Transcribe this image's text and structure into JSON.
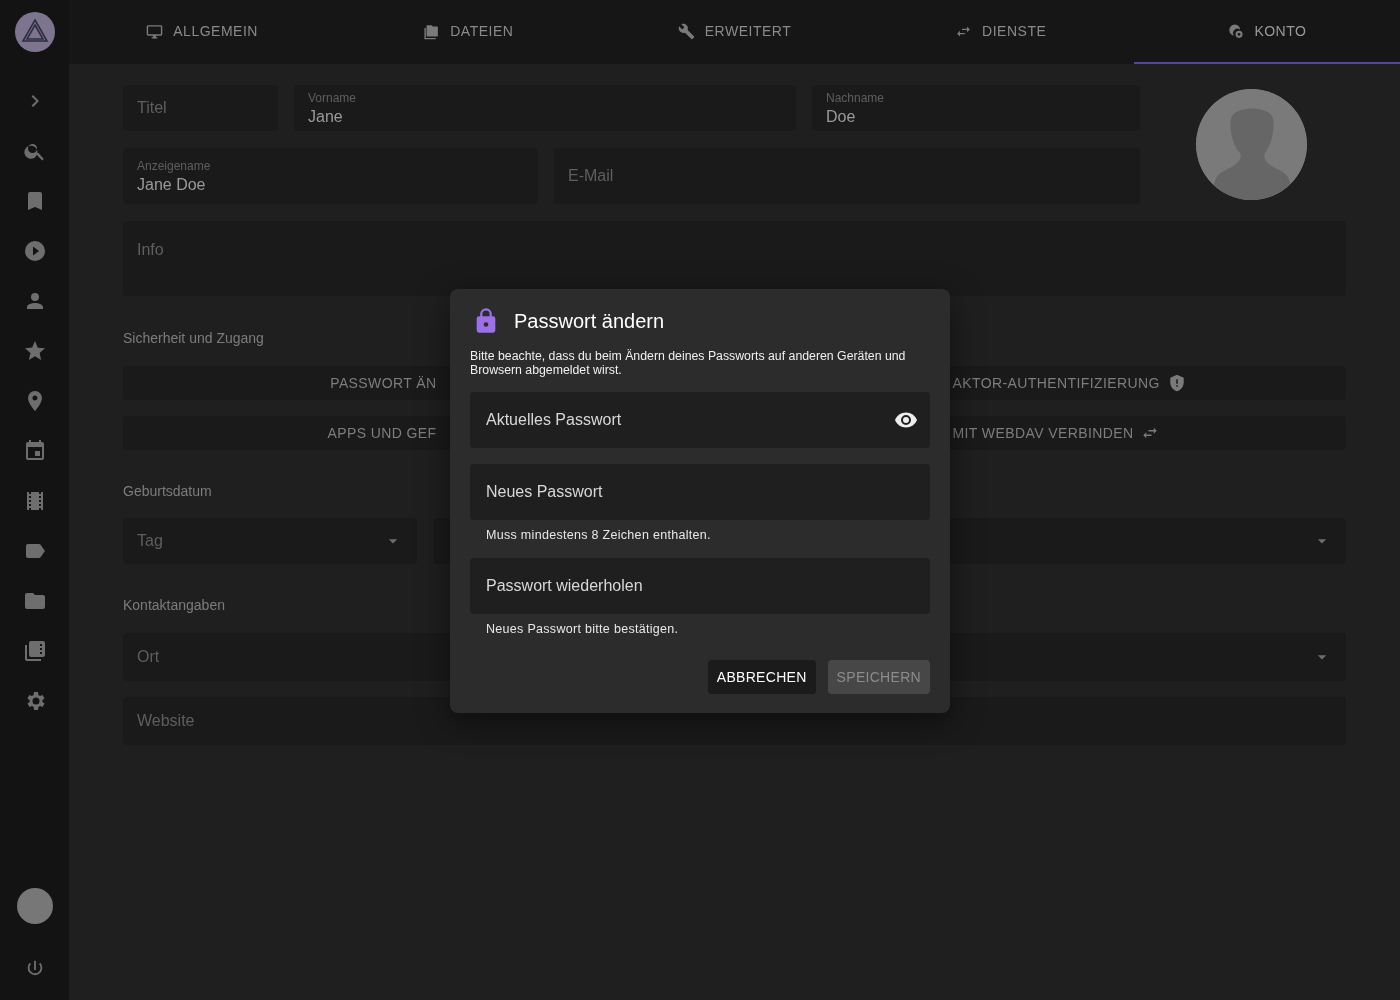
{
  "tabs": [
    {
      "label": "ALLGEMEIN",
      "selected": false
    },
    {
      "label": "DATEIEN",
      "selected": false
    },
    {
      "label": "ERWEITERT",
      "selected": false
    },
    {
      "label": "DIENSTE",
      "selected": false
    },
    {
      "label": "KONTO",
      "selected": true
    }
  ],
  "profile": {
    "fields": [
      {
        "placeholder": "Titel"
      },
      {
        "label": "Vorname",
        "value": "Jane"
      },
      {
        "label": "Nachname",
        "value": "Doe"
      },
      {
        "label": "Anzeigename",
        "value": "Jane Doe"
      },
      {
        "placeholder": "E-Mail"
      },
      {
        "placeholder": "Info"
      }
    ]
  },
  "security": {
    "heading": "Sicherheit und Zugang",
    "buttons": [
      {
        "label": "PASSWORT ÄN"
      },
      {
        "label": "AKTOR-AUTHENTIFIZIERUNG"
      },
      {
        "label": "APPS UND GEF"
      },
      {
        "label": "MIT WEBDAV VERBINDEN"
      }
    ]
  },
  "birthday": {
    "heading": "Geburtsdatum",
    "day": {
      "placeholder": "Tag"
    }
  },
  "contact": {
    "heading": "Kontaktangaben",
    "fields": [
      {
        "kind": "text",
        "placeholder": "Ort"
      },
      {
        "kind": "select"
      },
      {
        "kind": "text",
        "placeholder": "Website"
      }
    ]
  },
  "dialog": {
    "title": "Passwort ändern",
    "message": "Bitte beachte, dass du beim Ändern deines Passworts auf anderen Geräten und Browsern abgemeldet wirst.",
    "fields": [
      {
        "label": "Aktuelles Passwort",
        "reveal": true
      },
      {
        "label": "Neues Passwort",
        "reveal": false,
        "hint": "Muss mindestens 8 Zeichen enthalten."
      },
      {
        "label": "Passwort wiederholen",
        "reveal": false,
        "hint": "Neues Passwort bitte bestätigen."
      }
    ],
    "buttons": [
      {
        "label": "ABBRECHEN",
        "disabled": false
      },
      {
        "label": "SPEICHERN",
        "disabled": true
      }
    ]
  }
}
